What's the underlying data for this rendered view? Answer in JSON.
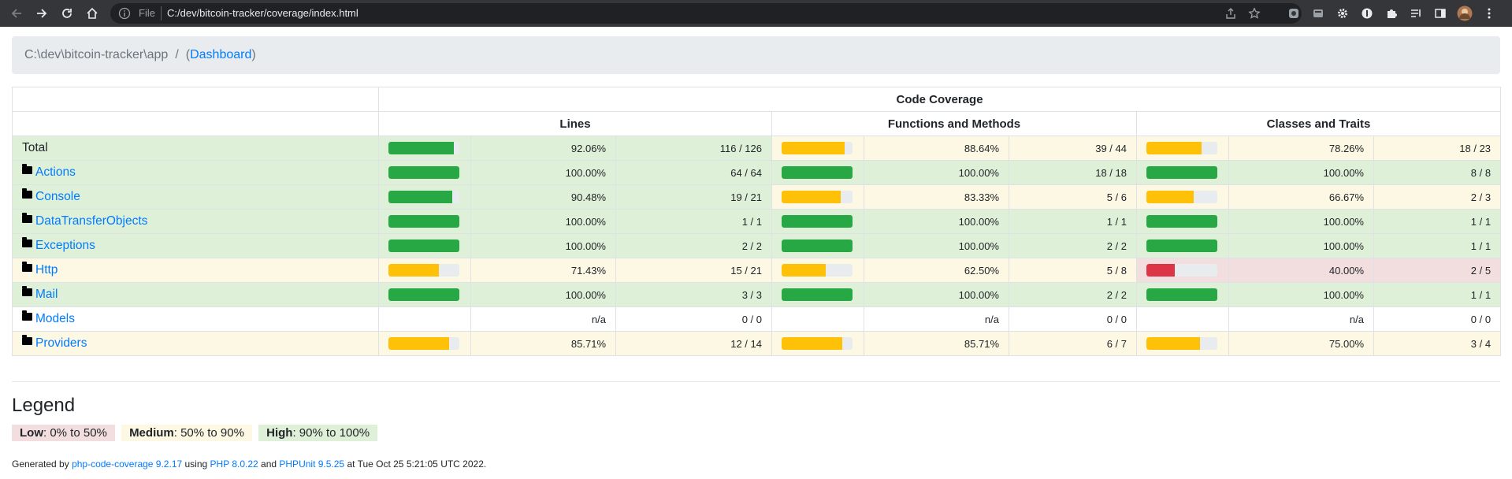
{
  "browser": {
    "file_label": "File",
    "url": "C:/dev/bitcoin-tracker/coverage/index.html"
  },
  "breadcrumb": {
    "path": "C:\\dev\\bitcoin-tracker\\app",
    "separator": "/",
    "open_paren": "(",
    "dashboard_link": "Dashboard",
    "close_paren": ")"
  },
  "table": {
    "header_code_coverage": "Code Coverage",
    "header_lines": "Lines",
    "header_functions": "Functions and Methods",
    "header_classes": "Classes and Traits",
    "rows": [
      {
        "name": "Total",
        "is_dir": false,
        "level": "success",
        "lines": {
          "pct": "92.06%",
          "cnt": "116 / 126",
          "fill": 92.06,
          "level": "success"
        },
        "funcs": {
          "pct": "88.64%",
          "cnt": "39 / 44",
          "fill": 88.64,
          "level": "warning"
        },
        "classes": {
          "pct": "78.26%",
          "cnt": "18 / 23",
          "fill": 78.26,
          "level": "warning"
        }
      },
      {
        "name": "Actions",
        "is_dir": true,
        "level": "success",
        "lines": {
          "pct": "100.00%",
          "cnt": "64 / 64",
          "fill": 100,
          "level": "success"
        },
        "funcs": {
          "pct": "100.00%",
          "cnt": "18 / 18",
          "fill": 100,
          "level": "success"
        },
        "classes": {
          "pct": "100.00%",
          "cnt": "8 / 8",
          "fill": 100,
          "level": "success"
        }
      },
      {
        "name": "Console",
        "is_dir": true,
        "level": "success",
        "lines": {
          "pct": "90.48%",
          "cnt": "19 / 21",
          "fill": 90.48,
          "level": "success"
        },
        "funcs": {
          "pct": "83.33%",
          "cnt": "5 / 6",
          "fill": 83.33,
          "level": "warning"
        },
        "classes": {
          "pct": "66.67%",
          "cnt": "2 / 3",
          "fill": 66.67,
          "level": "warning"
        }
      },
      {
        "name": "DataTransferObjects",
        "is_dir": true,
        "level": "success",
        "lines": {
          "pct": "100.00%",
          "cnt": "1 / 1",
          "fill": 100,
          "level": "success"
        },
        "funcs": {
          "pct": "100.00%",
          "cnt": "1 / 1",
          "fill": 100,
          "level": "success"
        },
        "classes": {
          "pct": "100.00%",
          "cnt": "1 / 1",
          "fill": 100,
          "level": "success"
        }
      },
      {
        "name": "Exceptions",
        "is_dir": true,
        "level": "success",
        "lines": {
          "pct": "100.00%",
          "cnt": "2 / 2",
          "fill": 100,
          "level": "success"
        },
        "funcs": {
          "pct": "100.00%",
          "cnt": "2 / 2",
          "fill": 100,
          "level": "success"
        },
        "classes": {
          "pct": "100.00%",
          "cnt": "1 / 1",
          "fill": 100,
          "level": "success"
        }
      },
      {
        "name": "Http",
        "is_dir": true,
        "level": "warning",
        "lines": {
          "pct": "71.43%",
          "cnt": "15 / 21",
          "fill": 71.43,
          "level": "warning"
        },
        "funcs": {
          "pct": "62.50%",
          "cnt": "5 / 8",
          "fill": 62.5,
          "level": "warning"
        },
        "classes": {
          "pct": "40.00%",
          "cnt": "2 / 5",
          "fill": 40,
          "level": "danger"
        }
      },
      {
        "name": "Mail",
        "is_dir": true,
        "level": "success",
        "lines": {
          "pct": "100.00%",
          "cnt": "3 / 3",
          "fill": 100,
          "level": "success"
        },
        "funcs": {
          "pct": "100.00%",
          "cnt": "2 / 2",
          "fill": 100,
          "level": "success"
        },
        "classes": {
          "pct": "100.00%",
          "cnt": "1 / 1",
          "fill": 100,
          "level": "success"
        }
      },
      {
        "name": "Models",
        "is_dir": true,
        "level": "none",
        "lines": {
          "pct": "n/a",
          "cnt": "0 / 0",
          "fill": null,
          "level": "none"
        },
        "funcs": {
          "pct": "n/a",
          "cnt": "0 / 0",
          "fill": null,
          "level": "none"
        },
        "classes": {
          "pct": "n/a",
          "cnt": "0 / 0",
          "fill": null,
          "level": "none"
        }
      },
      {
        "name": "Providers",
        "is_dir": true,
        "level": "warning",
        "lines": {
          "pct": "85.71%",
          "cnt": "12 / 14",
          "fill": 85.71,
          "level": "warning"
        },
        "funcs": {
          "pct": "85.71%",
          "cnt": "6 / 7",
          "fill": 85.71,
          "level": "warning"
        },
        "classes": {
          "pct": "75.00%",
          "cnt": "3 / 4",
          "fill": 75,
          "level": "warning"
        }
      }
    ]
  },
  "legend": {
    "title": "Legend",
    "low_label": "Low",
    "low_range": ": 0% to 50%",
    "medium_label": "Medium",
    "medium_range": ": 50% to 90%",
    "high_label": "High",
    "high_range": ": 90% to 100%"
  },
  "footer": {
    "generated_by": "Generated by ",
    "tool_link": "php-code-coverage 9.2.17",
    "using": " using ",
    "php_link": "PHP 8.0.22",
    "and": " and ",
    "phpunit_link": "PHPUnit 9.5.25",
    "at": " at Tue Oct 25 5:21:05 UTC 2022."
  },
  "colors": {
    "success_bg": "#dff0d8",
    "warning_bg": "#fcf8e3",
    "danger_bg": "#f2dede",
    "bar_green": "#28a745",
    "bar_yellow": "#ffc107",
    "bar_red": "#dc3545",
    "link": "#007bff"
  }
}
